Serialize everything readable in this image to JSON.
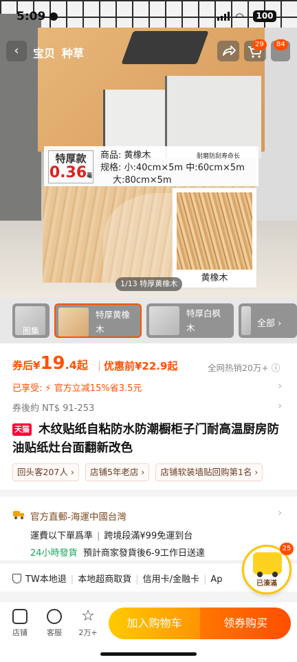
{
  "status_bar": {
    "time": "5:09",
    "battery": "100"
  },
  "header": {
    "tabs": [
      "宝贝",
      "种草"
    ],
    "cart_badge": "29",
    "more_badge": "84"
  },
  "hero": {
    "spec_tag_1": "特厚款",
    "spec_tag_2": "0.36",
    "spec_tag_unit": "毫米",
    "product_name": "商品: 黄橡木",
    "durability": "耐磨防刮寿命长",
    "spec_line_1": "规格: 小:40cm×5m 中:60cm×5m",
    "spec_line_2": "大:80cm×5m",
    "swatch_label": "黄橡木",
    "image_counter": "1/13 特厚黄橡木"
  },
  "thumbnails": {
    "picture_set": "图集",
    "items": [
      "特厚黄橡木",
      "特厚白枫木"
    ],
    "all_label": "全部"
  },
  "price": {
    "after_label": "券后",
    "currency": "¥",
    "int": "19",
    "dec": ".4起",
    "before": "优惠前¥22.9起",
    "sales": "全网热销20万+"
  },
  "promo": {
    "enjoyed": "已享受:",
    "discount": "官方立减15%省3.5元",
    "coupon_after": "券後約 NT$ 91-253"
  },
  "product": {
    "store_badge": "天猫",
    "title": "木纹贴纸自粘防水防潮橱柜子门耐高温厨房防油贴纸灶台面翻新改色",
    "tags": [
      "回头客207人",
      "店铺5年老店",
      "店铺软装墙贴回购第1名"
    ]
  },
  "shipping": {
    "title": "官方直郵-海運中國台灣",
    "fee": "運費以下單爲準",
    "free": "跨境段滿¥99免運到台",
    "ship_24": "24小時發貨",
    "estimate": "預計商家發貨後6-9工作日送達"
  },
  "guarantees": {
    "items": [
      "TW本地退",
      "本地超商取貨",
      "信用卡/金融卡",
      "Ap"
    ]
  },
  "floating": {
    "label": "已湊滿",
    "badge": "25"
  },
  "bottom_bar": {
    "store": "店铺",
    "service": "客服",
    "fav": "2万+",
    "add_cart": "加入购物车",
    "buy": "领券购买"
  },
  "colors": {
    "accent": "#ff5000",
    "tmall": "#ff0036",
    "ship_green": "#19a55a"
  }
}
